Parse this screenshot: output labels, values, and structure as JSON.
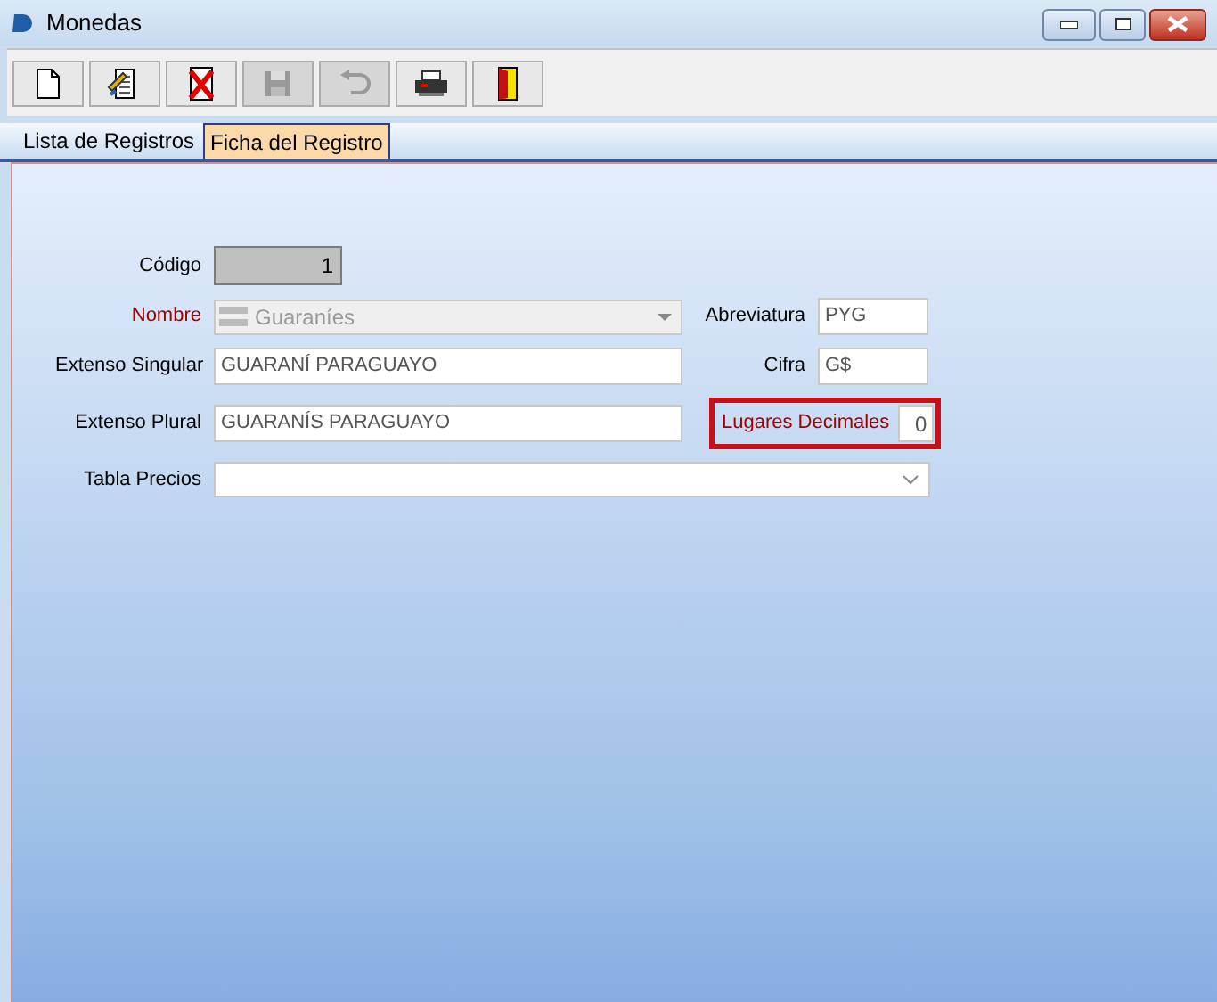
{
  "window": {
    "title": "Monedas"
  },
  "toolbar": [
    {
      "kind": "new",
      "disabled": false
    },
    {
      "kind": "edit",
      "disabled": false
    },
    {
      "kind": "delete",
      "disabled": false
    },
    {
      "kind": "save",
      "disabled": true
    },
    {
      "kind": "undo",
      "disabled": true
    },
    {
      "kind": "print",
      "disabled": false
    },
    {
      "kind": "exit",
      "disabled": false
    }
  ],
  "tabs": [
    {
      "label": "Lista de Registros",
      "selected": false
    },
    {
      "label": "Ficha del Registro",
      "selected": true
    }
  ],
  "form": {
    "codigo": {
      "label": "Código",
      "value": "1",
      "required": false
    },
    "nombre": {
      "label": "Nombre",
      "value": "Guaraníes",
      "required": true,
      "disabled": true
    },
    "extenso_singular": {
      "label": "Extenso Singular",
      "value": "GUARANÍ PARAGUAYO",
      "required": false
    },
    "extenso_plural": {
      "label": "Extenso Plural",
      "value": "GUARANÍS PARAGUAYO",
      "required": false
    },
    "tabla_precios": {
      "label": "Tabla Precios",
      "required": false
    },
    "abreviatura": {
      "label": "Abreviatura",
      "value": "PYG",
      "required": false
    },
    "cifra": {
      "label": "Cifra",
      "value": "G$",
      "required": false
    },
    "lugares_decimales": {
      "label": "Lugares Decimales",
      "value": "0",
      "required": true,
      "highlighted": true
    }
  }
}
